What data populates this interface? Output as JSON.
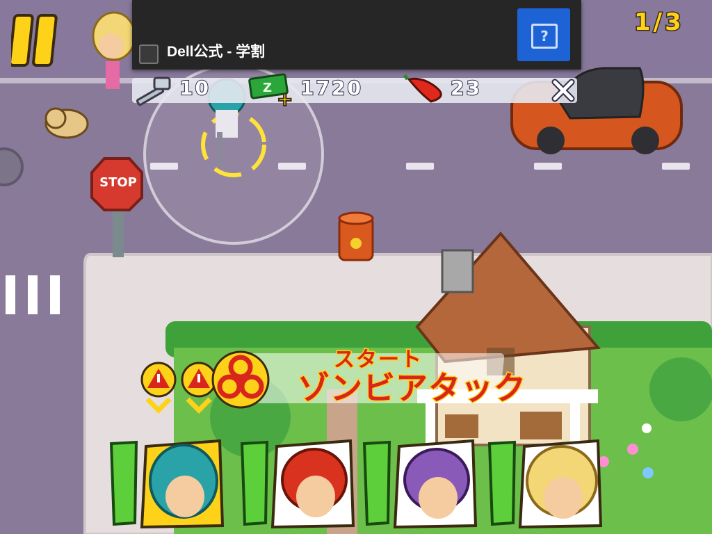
{
  "ad": {
    "text": "Dell公式 - 学割",
    "info_icon": "info-question-icon"
  },
  "hud": {
    "wave_counter": "1/3",
    "hammer_count": "10",
    "cash_count": "1720",
    "chili_count": "23",
    "close_icon": "close-x-icon",
    "pause_icon": "pause-icon"
  },
  "banner": {
    "start_label": "スタート",
    "attack_label": "ゾンビアタック"
  },
  "signs": {
    "stop_sign": "STOP"
  },
  "characters": [
    {
      "name": "teal-hair-girl",
      "hair": "#2aa3a8"
    },
    {
      "name": "red-hair-girl",
      "hair": "#d9331f"
    },
    {
      "name": "purple-hair-girl",
      "hair": "#8a5ab8"
    },
    {
      "name": "blonde-girl",
      "hair": "#f3d675"
    }
  ],
  "colors": {
    "road": "#8a7a9a",
    "sidewalk": "#e8e0e0",
    "grass": "#6cbf4a",
    "accent_yellow": "#ffd21a",
    "accent_red": "#d9261c",
    "ad_button": "#1e63d6"
  }
}
